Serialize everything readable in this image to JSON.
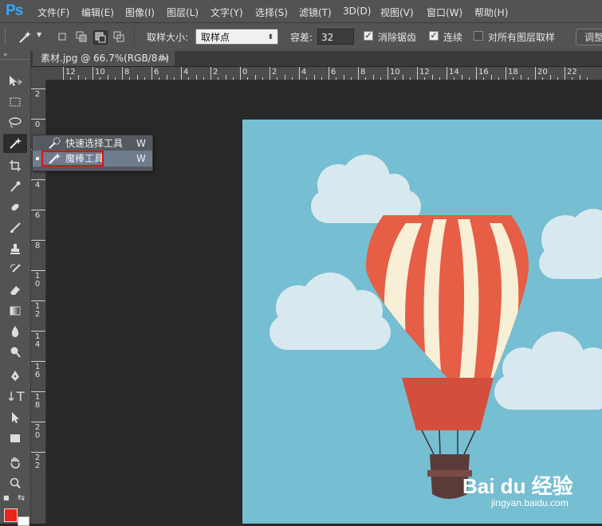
{
  "app": {
    "logo": "Ps"
  },
  "menu": [
    "文件(F)",
    "编辑(E)",
    "图像(I)",
    "图层(L)",
    "文字(Y)",
    "选择(S)",
    "滤镜(T)",
    "3D(D)",
    "视图(V)",
    "窗口(W)",
    "帮助(H)"
  ],
  "options": {
    "sample_size_label": "取样大小:",
    "sample_size_value": "取样点",
    "tolerance_label": "容差:",
    "tolerance_value": "32",
    "antialias_label": "消除锯齿",
    "antialias_checked": true,
    "contiguous_label": "连续",
    "contiguous_checked": true,
    "sample_all_label": "对所有图层取样",
    "sample_all_checked": false,
    "refine_label": "调整"
  },
  "document": {
    "tab_title": "素材.jpg @ 66.7%(RGB/8#)",
    "close_glyph": "×"
  },
  "rulers": {
    "h_labels": [
      "12",
      "10",
      "8",
      "6",
      "4",
      "2",
      "0",
      "2",
      "4",
      "6",
      "8",
      "10",
      "12",
      "14",
      "16",
      "18",
      "20",
      "22"
    ],
    "v_labels": [
      "2",
      "0",
      "2",
      "4",
      "6",
      "8",
      "10",
      "12",
      "14",
      "16",
      "18",
      "20",
      "22"
    ]
  },
  "flyout": {
    "items": [
      {
        "label": "快速选择工具",
        "shortcut": "W",
        "selected": false
      },
      {
        "label": "魔棒工具",
        "shortcut": "W",
        "selected": true
      }
    ]
  },
  "watermark": {
    "brand": "Bai du 经验",
    "url": "jingyan.baidu.com"
  },
  "colors": {
    "foreground": "#e8261a",
    "background": "#ffffff",
    "canvas_sky": "#76bed2",
    "balloon_red": "#e65e45",
    "balloon_cream": "#f7efd6",
    "cloud": "#d7e9ef",
    "highlight": "#e01010"
  }
}
